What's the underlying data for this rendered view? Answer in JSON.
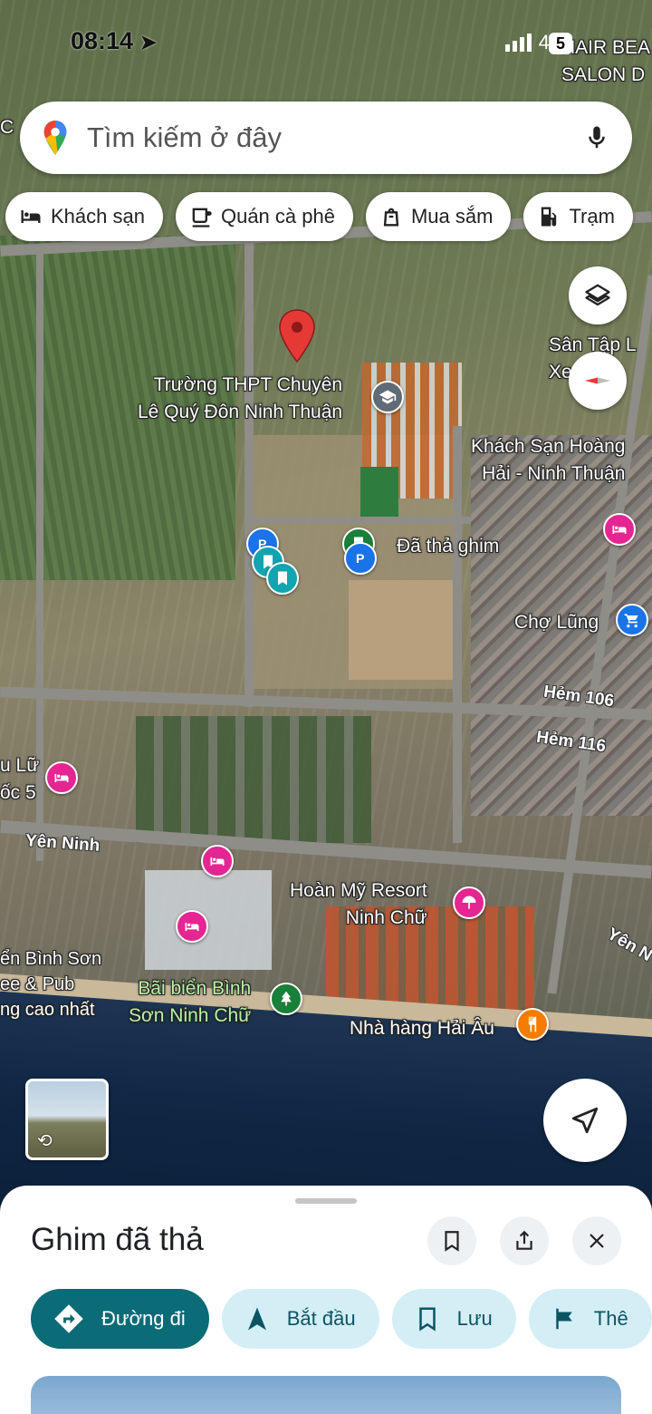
{
  "status_bar": {
    "time": "08:14",
    "network": "4G",
    "battery": "5"
  },
  "search": {
    "placeholder": "Tìm kiếm ở đây"
  },
  "chips": [
    {
      "label": "Khách sạn",
      "icon": "bed-icon"
    },
    {
      "label": "Quán cà phê",
      "icon": "coffee-icon"
    },
    {
      "label": "Mua sắm",
      "icon": "shopping-bag-icon"
    },
    {
      "label": "Trạm",
      "icon": "gas-station-icon"
    }
  ],
  "map": {
    "labels": {
      "school": "Trường THPT Chuyên\nLê Quý Đôn Ninh Thuận",
      "hotel_hoang_hai": "Khách Sạn Hoàng\nHải - Ninh Thuận",
      "dropped_pin": "Đã thả ghim",
      "cho_lung": "Chợ Lũng",
      "hem_106": "Hẻm 106",
      "hem_116": "Hẻm 116",
      "yen_ninh_left": "Yên Ninh",
      "yen_ninh_right": "Yên N",
      "hoan_my": "Hoàn Mỹ Resort\nNinh Chữ",
      "beach": "Bãi biển Bình\nSơn Ninh Chữ",
      "nha_hang": "Nhà hàng Hải Âu",
      "san_tap": "Sân Tập L\nXe   OÀ",
      "hair_salon": "HAIR BEA\nSALON D",
      "left_edge_1": "u Lữ\nốc 5",
      "left_edge_2": "ển Bình Sơn\nee & Pub\nng cao nhất",
      "top_left": "C"
    },
    "colors": {
      "pin": "#e53935",
      "lodging": "#e52592",
      "parking": "#1a73e8",
      "teal": "#12a4af",
      "park": "#188038",
      "food": "#f57c00",
      "shop": "#1a73e8"
    }
  },
  "sheet": {
    "title": "Ghim đã thả",
    "actions": [
      {
        "label": "Đường đi",
        "icon": "directions-icon"
      },
      {
        "label": "Bắt đầu",
        "icon": "navigation-arrow-icon"
      },
      {
        "label": "Lưu",
        "icon": "bookmark-icon"
      },
      {
        "label": "Thê",
        "icon": "flag-icon"
      }
    ]
  }
}
